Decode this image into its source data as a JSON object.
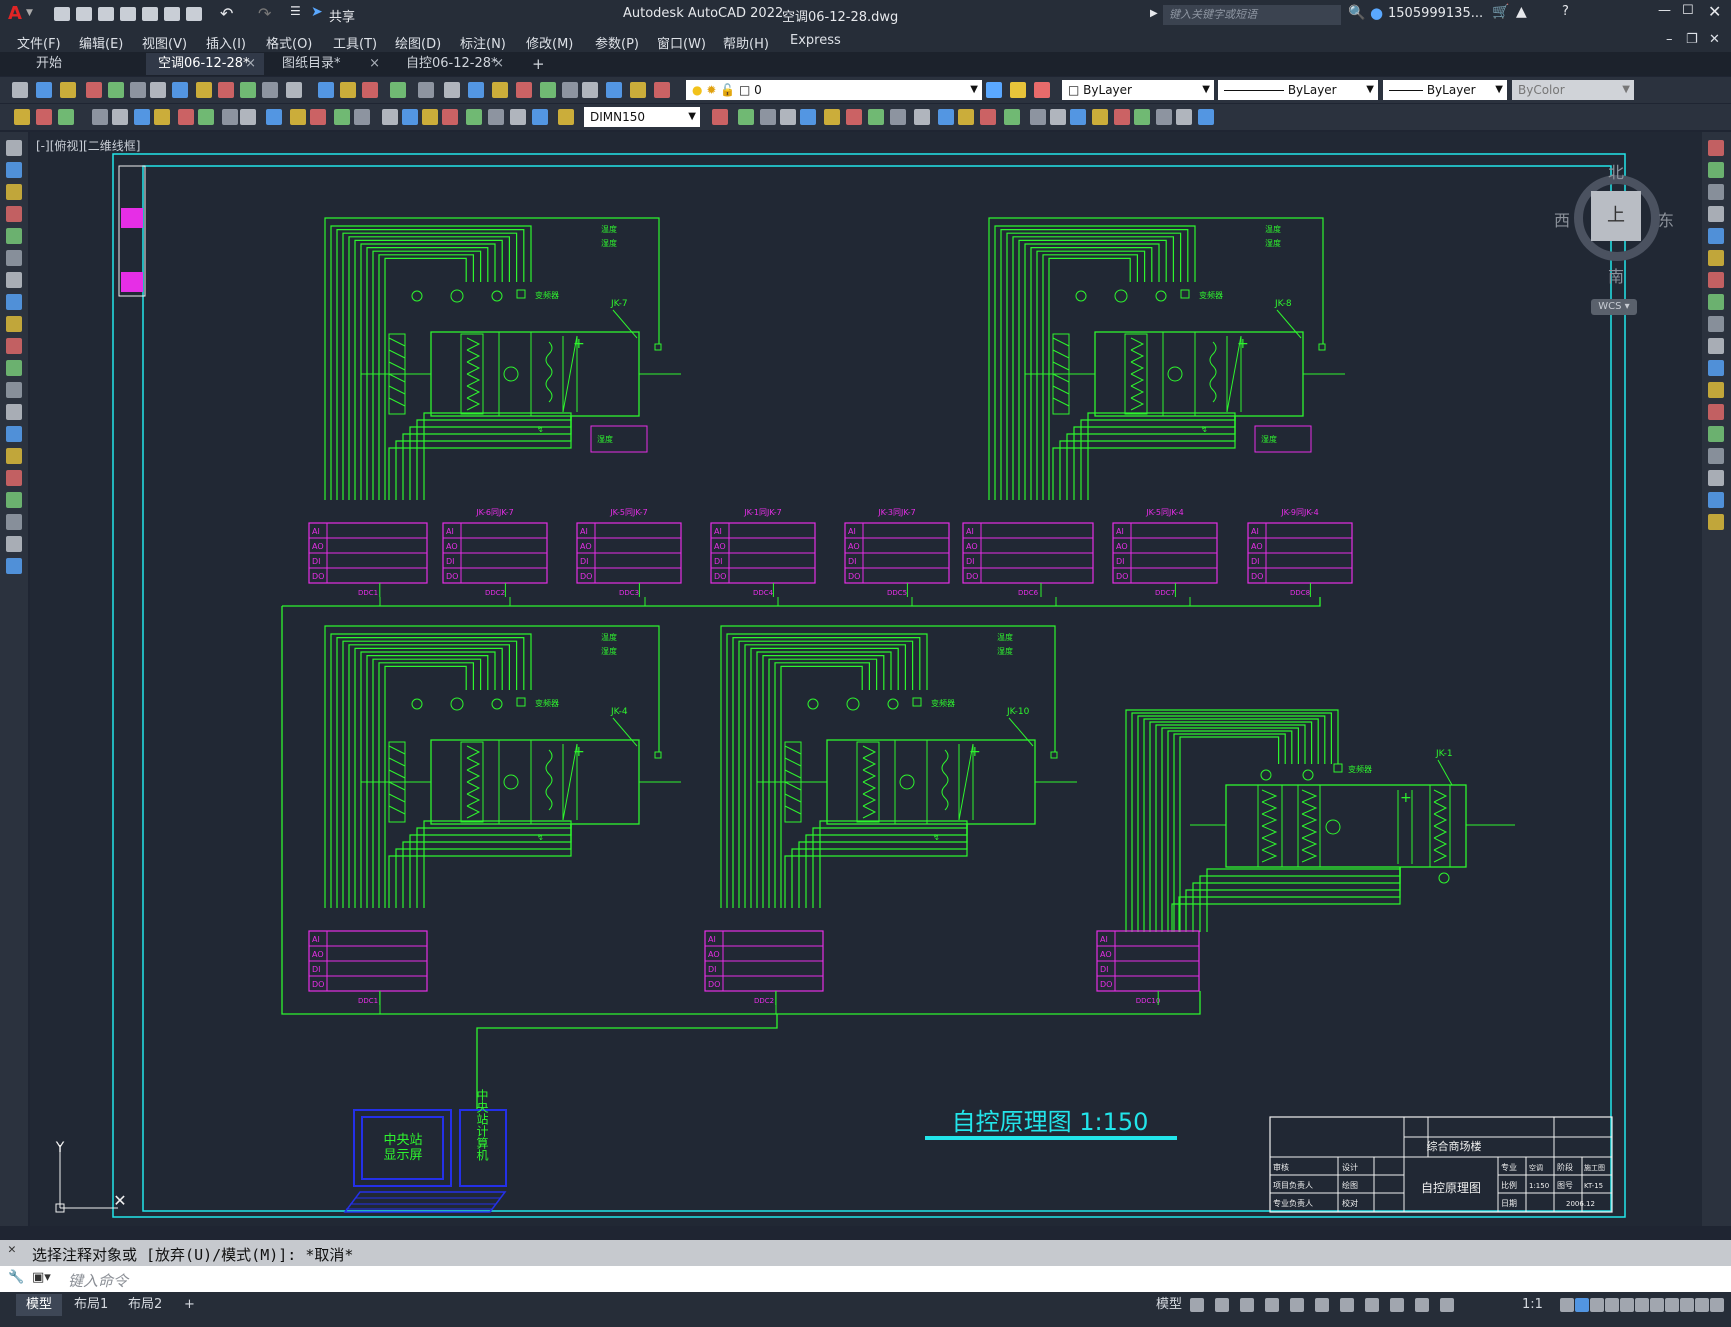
{
  "app": {
    "title": "Autodesk AutoCAD 2022",
    "filename": "空调06-12-28.dwg",
    "logo": "A",
    "share": "共享",
    "search_placeholder": "键入关键字或短语",
    "user": "1505999135...",
    "help": "?"
  },
  "menu": [
    "文件(F)",
    "编辑(E)",
    "视图(V)",
    "插入(I)",
    "格式(O)",
    "工具(T)",
    "绘图(D)",
    "标注(N)",
    "修改(M)",
    "参数(P)",
    "窗口(W)",
    "帮助(H)",
    "Express"
  ],
  "tabs": [
    {
      "label": "开始",
      "close": ""
    },
    {
      "label": "空调06-12-28*",
      "close": "×"
    },
    {
      "label": "图纸目录*",
      "close": "×"
    },
    {
      "label": "自控06-12-28*",
      "close": "×"
    },
    {
      "label": "+",
      "close": ""
    }
  ],
  "toolbar": {
    "layer": "0",
    "color": "ByLayer",
    "linetype": "ByLayer",
    "lineweight": "ByLayer",
    "plotstyle": "ByColor",
    "dimstyle": "DIMN150"
  },
  "viewport_label": "[-][俯视][二维线框]",
  "viewcube": {
    "north": "北",
    "south": "南",
    "east": "东",
    "west": "西",
    "top": "上",
    "wcs": "WCS"
  },
  "drawing": {
    "title": "自控原理图 1:150",
    "labels": {
      "temp": "温度",
      "humid": "湿度",
      "vfd": "变频器",
      "ai": "AI",
      "ao": "AO",
      "di": "DI",
      "do": "DO"
    },
    "ahu_tags": [
      "JK-7",
      "JK-8",
      "JK-4",
      "JK-10",
      "JK-1"
    ],
    "ddc_panels": [
      "DDC1",
      "DDC2",
      "DDC3",
      "DDC4",
      "DDC5",
      "DDC6",
      "DDC7",
      "DDC8"
    ],
    "ddc_headers": [
      "JK-6同JK-7",
      "JK-5同JK-7",
      "JK-1同JK-7",
      "JK-3同JK-7",
      "JK-5同JK-4",
      "JK-9同JK-4"
    ],
    "ddc_bottom": [
      "DDC1",
      "DDC2",
      "DDC10"
    ],
    "central_station": "中央站显示屏",
    "central_computer": "中央站计算机",
    "title_block": {
      "project": "综合商场楼",
      "drawing_name": "自控原理图",
      "r1": [
        "审核",
        "设计"
      ],
      "r2": [
        "项目负责人",
        "绘图"
      ],
      "r3": [
        "专业负责人",
        "校对"
      ],
      "c1": [
        "专业",
        "空调",
        "阶段",
        "施工图"
      ],
      "c2": [
        "比例",
        "1:150",
        "图号",
        "KT-15"
      ],
      "c3": [
        "日期",
        "",
        "2006.12"
      ]
    }
  },
  "command": {
    "history": "选择注释对象或 [放弃(U)/模式(M)]: *取消*",
    "placeholder": "键入命令"
  },
  "status": {
    "tabs": [
      "模型",
      "布局1",
      "布局2",
      "+"
    ],
    "model": "模型",
    "scale": "1:1"
  },
  "colors": {
    "green": "#2ef52e",
    "magenta": "#e62ee6",
    "cyan": "#22e5ea",
    "blue": "#2430e8",
    "white": "#f0f0f0"
  }
}
